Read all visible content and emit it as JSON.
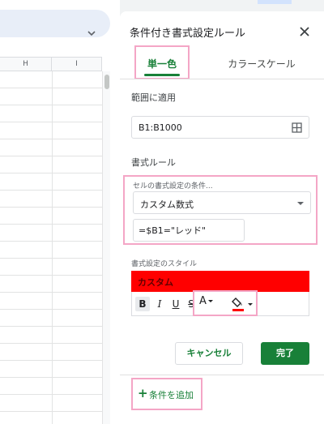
{
  "sheet": {
    "columns": [
      "H",
      "I"
    ]
  },
  "panel": {
    "title": "条件付き書式設定ルール",
    "tabs": {
      "single": "単一色",
      "color_scale": "カラースケール"
    },
    "range": {
      "label": "範囲に適用",
      "value": "B1:B1000"
    },
    "format_rules": {
      "heading": "書式ルール",
      "condition_label": "セルの書式設定の条件...",
      "condition_value": "カスタム数式",
      "formula_value": "=$B1=\"レッド\""
    },
    "style": {
      "label": "書式設定のスタイル",
      "preview_text": "カスタム",
      "preview_color": "#ff0000",
      "buttons": {
        "bold": "B",
        "italic": "I",
        "underline": "U",
        "strike": "S",
        "text_color": "A"
      }
    },
    "actions": {
      "cancel": "キャンセル",
      "done": "完了"
    },
    "add_rule": {
      "plus": "+",
      "label": "条件を追加"
    }
  },
  "colors": {
    "accent_green": "#188038",
    "highlight_pink": "#f4a6c6",
    "fill_red": "#ff0000"
  },
  "icons": {
    "close": "close-icon",
    "grid": "grid-select-icon",
    "fill": "fill-color-icon",
    "chevron": "chevron-down-icon"
  }
}
